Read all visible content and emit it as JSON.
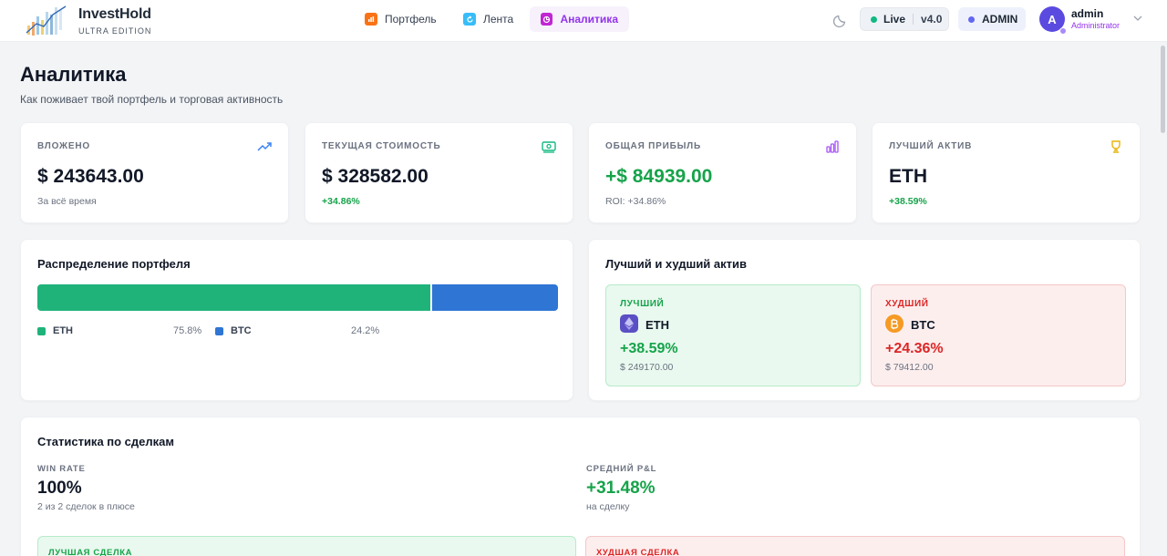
{
  "app": {
    "name": "InvestHold",
    "edition": "ULTRA EDITION"
  },
  "nav": {
    "tabs": [
      {
        "label": "Портфель",
        "icon": "portfolio-icon",
        "color": "#f97316",
        "active": false
      },
      {
        "label": "Лента",
        "icon": "feed-icon",
        "color": "#38bdf8",
        "active": false
      },
      {
        "label": "Аналитика",
        "icon": "analytics-icon",
        "color": "#c026d3",
        "active": true
      }
    ]
  },
  "status": {
    "live_label": "Live",
    "version": "v4.0",
    "role_badge": "ADMIN"
  },
  "user": {
    "initial": "A",
    "name": "admin",
    "role": "Administrator"
  },
  "page": {
    "title": "Аналитика",
    "subtitle": "Как поживает твой портфель и торговая активность"
  },
  "stats": [
    {
      "label": "ВЛОЖЕНО",
      "value": "$ 243643.00",
      "note": "За всё время",
      "icon": "trending-up-icon"
    },
    {
      "label": "ТЕКУЩАЯ СТОИМОСТЬ",
      "value": "$ 328582.00",
      "note": "+34.86%",
      "icon": "cash-icon"
    },
    {
      "label": "ОБЩАЯ ПРИБЫЛЬ",
      "value": "+$ 84939.00",
      "note": "ROI: +34.86%",
      "icon": "bar-chart-icon"
    },
    {
      "label": "ЛУЧШИЙ АКТИВ",
      "value": "ETH",
      "note": "+38.59%",
      "icon": "trophy-icon"
    }
  ],
  "allocation": {
    "title": "Распределение портфеля",
    "items": [
      {
        "name": "ETH",
        "percent": 75.8,
        "percent_label": "75.8%",
        "color": "#1fb37a"
      },
      {
        "name": "BTC",
        "percent": 24.2,
        "percent_label": "24.2%",
        "color": "#2e75d4"
      }
    ]
  },
  "best_worst": {
    "title": "Лучший и худший актив",
    "best": {
      "kind": "ЛУЧШИЙ",
      "symbol": "ETH",
      "change": "+38.59%",
      "amount": "$ 249170.00",
      "icon": "ethereum-icon"
    },
    "worst": {
      "kind": "ХУДШИЙ",
      "symbol": "BTC",
      "change": "+24.36%",
      "amount": "$ 79412.00",
      "icon": "bitcoin-icon"
    }
  },
  "trades": {
    "title": "Статистика по сделкам",
    "win_rate": {
      "label": "WIN RATE",
      "value": "100%",
      "note": "2 из 2 сделок в плюсе"
    },
    "avg_pnl": {
      "label": "СРЕДНИЙ P&L",
      "value": "+31.48%",
      "note": "на сделку"
    },
    "best_deal_label": "ЛУЧШАЯ СДЕЛКА",
    "worst_deal_label": "ХУДШАЯ СДЕЛКА"
  }
}
